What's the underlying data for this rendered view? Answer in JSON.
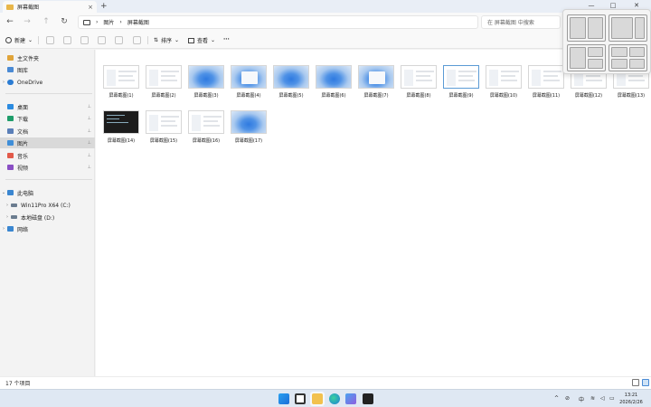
{
  "tab": {
    "title": "屏幕截图",
    "close": "×",
    "new": "+"
  },
  "window": {
    "minimize": "—",
    "maximize": "□",
    "close": "✕"
  },
  "nav": {
    "back": "←",
    "forward": "→",
    "up": "↑",
    "refresh": "↻"
  },
  "breadcrumb": {
    "items": [
      "图片",
      "屏幕截图"
    ],
    "separator": "›"
  },
  "search": {
    "placeholder": "在 屏幕截图 中搜索",
    "icon": "search-icon"
  },
  "command_bar": {
    "new_label": "新建",
    "sort_label": "排序",
    "view_label": "查看",
    "more_label": "···"
  },
  "sidebar": {
    "quick": [
      {
        "label": "主文件夹",
        "icon": "home-icon",
        "color": "#e0a43a"
      },
      {
        "label": "图库",
        "icon": "gallery-icon",
        "color": "#4a8ad4"
      },
      {
        "label": "OneDrive",
        "icon": "cloud-icon",
        "color": "#2b7cd3",
        "expandable": true
      }
    ],
    "pinned": [
      {
        "label": "桌面",
        "icon": "desktop-icon",
        "color": "#2b8be0"
      },
      {
        "label": "下载",
        "icon": "download-icon",
        "color": "#1f9d6a"
      },
      {
        "label": "文档",
        "icon": "document-icon",
        "color": "#5a7fb8"
      },
      {
        "label": "图片",
        "icon": "pictures-icon",
        "color": "#3f8ed8",
        "selected": true
      },
      {
        "label": "音乐",
        "icon": "music-icon",
        "color": "#e25a4a"
      },
      {
        "label": "视频",
        "icon": "video-icon",
        "color": "#8a4fc4"
      }
    ],
    "devices": [
      {
        "label": "此电脑",
        "icon": "pc-icon",
        "color": "#3a86d0",
        "expanded": true
      },
      {
        "label": "Win11Pro X64 (C:)",
        "icon": "drive-icon",
        "color": "#6b7c8f",
        "child": true
      },
      {
        "label": "本地磁盘 (D:)",
        "icon": "drive-icon",
        "color": "#6b7c8f",
        "child": true
      },
      {
        "label": "网络",
        "icon": "network-icon",
        "color": "#3a86d0"
      }
    ]
  },
  "files": [
    {
      "name": "屏幕截图(1)",
      "thumb": "light"
    },
    {
      "name": "屏幕截图(2)",
      "thumb": "light"
    },
    {
      "name": "屏幕截图(3)",
      "thumb": "blue"
    },
    {
      "name": "屏幕截图(4)",
      "thumb": "blue-window"
    },
    {
      "name": "屏幕截图(5)",
      "thumb": "blue"
    },
    {
      "name": "屏幕截图(6)",
      "thumb": "blue"
    },
    {
      "name": "屏幕截图(7)",
      "thumb": "blue-window"
    },
    {
      "name": "屏幕截图(8)",
      "thumb": "light"
    },
    {
      "name": "屏幕截图(9)",
      "thumb": "light-selected"
    },
    {
      "name": "屏幕截图(10)",
      "thumb": "light"
    },
    {
      "name": "屏幕截图(11)",
      "thumb": "light"
    },
    {
      "name": "屏幕截图(12)",
      "thumb": "light"
    },
    {
      "name": "屏幕截图(13)",
      "thumb": "light"
    },
    {
      "name": "屏幕截图(14)",
      "thumb": "dark"
    },
    {
      "name": "屏幕截图(15)",
      "thumb": "light"
    },
    {
      "name": "屏幕截图(16)",
      "thumb": "light"
    },
    {
      "name": "屏幕截图(17)",
      "thumb": "blue"
    }
  ],
  "status": {
    "count": "17 个项目"
  },
  "taskbar": {
    "apps": [
      "windows-start-icon",
      "task-view-icon",
      "file-explorer-icon",
      "edge-icon",
      "store-icon",
      "terminal-icon"
    ],
    "tray_lang": "中",
    "tray_up": "^",
    "time": "13:21",
    "date": "2026/2/26"
  }
}
